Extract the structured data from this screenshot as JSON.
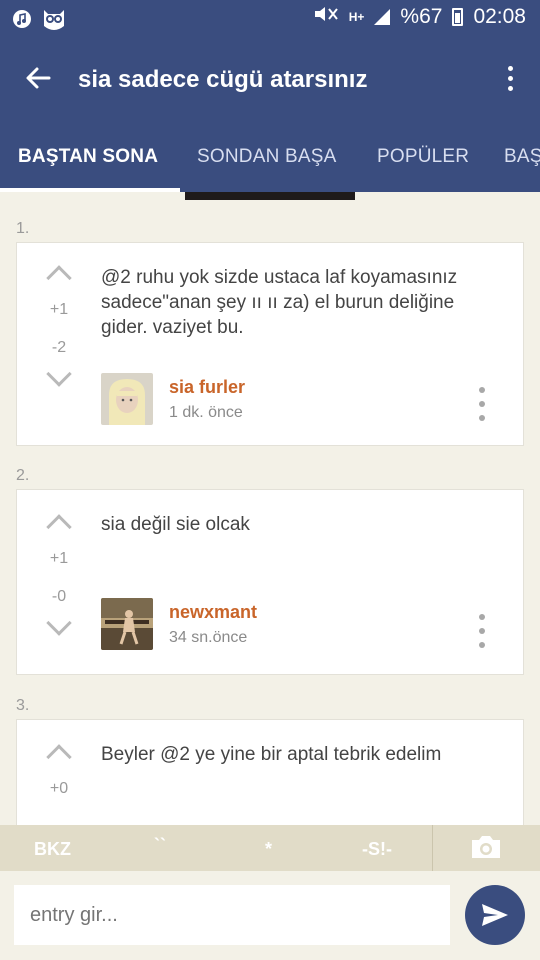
{
  "status_bar": {
    "battery": "%67",
    "time": "02:08",
    "network": "H+"
  },
  "toolbar": {
    "title": "sia sadece cügü atarsınız"
  },
  "tabs": [
    {
      "label": "BAŞTAN SONA",
      "active": true
    },
    {
      "label": "SONDAN BAŞA",
      "active": false
    },
    {
      "label": "POPÜLER",
      "active": false
    },
    {
      "label": "BAŞ",
      "active": false
    }
  ],
  "entries": [
    {
      "index": "1.",
      "text": "@2 ruhu yok sizde ustaca laf koyamasınız sadece\"anan şey ıı ıı za) el burun deliğine gider. vaziyet bu.",
      "upvotes": "+1",
      "downvotes": "-2",
      "author": "sia furler",
      "time": "1 dk. önce"
    },
    {
      "index": "2.",
      "text": "sia değil sie olcak",
      "upvotes": "+1",
      "downvotes": "-0",
      "author": "newxmant",
      "time": "34 sn.önce"
    },
    {
      "index": "3.",
      "text": "Beyler @2 ye yine bir aptal tebrik edelim",
      "upvotes": "+0",
      "downvotes": "",
      "author": "",
      "time": ""
    }
  ],
  "format_bar": {
    "bkz": "BKZ",
    "backtick": "``",
    "asterisk": "*",
    "spoiler": "-S!-"
  },
  "compose": {
    "placeholder": "entry gir..."
  },
  "colors": {
    "primary": "#3a4d7f",
    "background": "#f3f1e7",
    "username": "#c9652a",
    "format_bar": "#e1dcc8"
  }
}
